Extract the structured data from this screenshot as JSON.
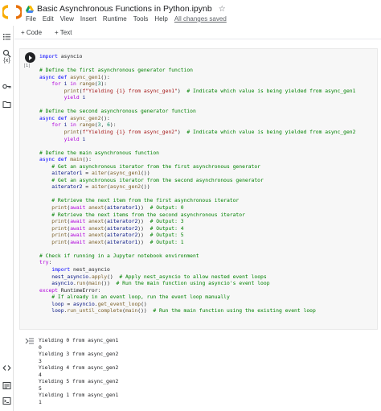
{
  "header": {
    "title": "Basic Asynchronous Functions in Python.ipynb",
    "star_glyph": "☆",
    "menu": [
      "File",
      "Edit",
      "View",
      "Insert",
      "Runtime",
      "Tools",
      "Help"
    ],
    "saved_status": "All changes saved"
  },
  "toolbar": {
    "add_code_label": "+ Code",
    "add_text_label": "+ Text"
  },
  "rail": {
    "icons": [
      "toc-icon",
      "search-icon",
      "variables-icon",
      "secrets-key-icon",
      "folder-icon",
      "code-snippets-icon",
      "command-palette-icon",
      "terminal-icon"
    ],
    "variables_glyph": "{x}"
  },
  "cell": {
    "exec_count": "[1]",
    "code_lines": [
      [
        [
          "kw",
          "import"
        ],
        [
          "p",
          " asyncio"
        ]
      ],
      [],
      [
        [
          "cmt",
          "# Define the first asynchronous generator function"
        ]
      ],
      [
        [
          "kw",
          "async def"
        ],
        [
          "fn",
          " async_gen1"
        ],
        [
          "p",
          "():"
        ]
      ],
      [
        [
          "p",
          "    "
        ],
        [
          "ctl",
          "for"
        ],
        [
          "var",
          " i"
        ],
        [
          "ctl",
          " in"
        ],
        [
          "bi",
          " range"
        ],
        [
          "p",
          "("
        ],
        [
          "num",
          "3"
        ],
        [
          "p",
          "):"
        ]
      ],
      [
        [
          "p",
          "        "
        ],
        [
          "bi",
          "print"
        ],
        [
          "p",
          "("
        ],
        [
          "str",
          "f\"Yielding {i} from async_gen1\""
        ],
        [
          "p",
          ")  "
        ],
        [
          "cmt",
          "# Indicate which value is being yielded from async_gen1"
        ]
      ],
      [
        [
          "p",
          "        "
        ],
        [
          "ctl",
          "yield"
        ],
        [
          "var",
          " i"
        ]
      ],
      [],
      [
        [
          "cmt",
          "# Define the second asynchronous generator function"
        ]
      ],
      [
        [
          "kw",
          "async def"
        ],
        [
          "fn",
          " async_gen2"
        ],
        [
          "p",
          "():"
        ]
      ],
      [
        [
          "p",
          "    "
        ],
        [
          "ctl",
          "for"
        ],
        [
          "var",
          " i"
        ],
        [
          "ctl",
          " in"
        ],
        [
          "bi",
          " range"
        ],
        [
          "p",
          "("
        ],
        [
          "num",
          "3"
        ],
        [
          "p",
          ", "
        ],
        [
          "num",
          "6"
        ],
        [
          "p",
          "):"
        ]
      ],
      [
        [
          "p",
          "        "
        ],
        [
          "bi",
          "print"
        ],
        [
          "p",
          "("
        ],
        [
          "str",
          "f\"Yielding {i} from async_gen2\""
        ],
        [
          "p",
          ")  "
        ],
        [
          "cmt",
          "# Indicate which value is being yielded from async_gen2"
        ]
      ],
      [
        [
          "p",
          "        "
        ],
        [
          "ctl",
          "yield"
        ],
        [
          "var",
          " i"
        ]
      ],
      [],
      [
        [
          "cmt",
          "# Define the main asynchronous function"
        ]
      ],
      [
        [
          "kw",
          "async def"
        ],
        [
          "fn",
          " main"
        ],
        [
          "p",
          "():"
        ]
      ],
      [
        [
          "p",
          "    "
        ],
        [
          "cmt",
          "# Get an asynchronous iterator from the first asynchronous generator"
        ]
      ],
      [
        [
          "p",
          "    "
        ],
        [
          "var",
          "aiterator1"
        ],
        [
          "p",
          " = "
        ],
        [
          "bi",
          "aiter"
        ],
        [
          "p",
          "("
        ],
        [
          "fn",
          "async_gen1"
        ],
        [
          "p",
          "())"
        ]
      ],
      [
        [
          "p",
          "    "
        ],
        [
          "cmt",
          "# Get an asynchronous iterator from the second asynchronous generator"
        ]
      ],
      [
        [
          "p",
          "    "
        ],
        [
          "var",
          "aiterator2"
        ],
        [
          "p",
          " = "
        ],
        [
          "bi",
          "aiter"
        ],
        [
          "p",
          "("
        ],
        [
          "fn",
          "async_gen2"
        ],
        [
          "p",
          "())"
        ]
      ],
      [],
      [
        [
          "p",
          "    "
        ],
        [
          "cmt",
          "# Retrieve the next item from the first asynchronous iterator"
        ]
      ],
      [
        [
          "p",
          "    "
        ],
        [
          "bi",
          "print"
        ],
        [
          "p",
          "("
        ],
        [
          "ctl",
          "await"
        ],
        [
          "bi",
          " anext"
        ],
        [
          "p",
          "("
        ],
        [
          "var",
          "aiterator1"
        ],
        [
          "p",
          "))  "
        ],
        [
          "cmt",
          "# Output: 0"
        ]
      ],
      [
        [
          "p",
          "    "
        ],
        [
          "cmt",
          "# Retrieve the next items from the second asynchronous iterator"
        ]
      ],
      [
        [
          "p",
          "    "
        ],
        [
          "bi",
          "print"
        ],
        [
          "p",
          "("
        ],
        [
          "ctl",
          "await"
        ],
        [
          "bi",
          " anext"
        ],
        [
          "p",
          "("
        ],
        [
          "var",
          "aiterator2"
        ],
        [
          "p",
          "))  "
        ],
        [
          "cmt",
          "# Output: 3"
        ]
      ],
      [
        [
          "p",
          "    "
        ],
        [
          "bi",
          "print"
        ],
        [
          "p",
          "("
        ],
        [
          "ctl",
          "await"
        ],
        [
          "bi",
          " anext"
        ],
        [
          "p",
          "("
        ],
        [
          "var",
          "aiterator2"
        ],
        [
          "p",
          "))  "
        ],
        [
          "cmt",
          "# Output: 4"
        ]
      ],
      [
        [
          "p",
          "    "
        ],
        [
          "bi",
          "print"
        ],
        [
          "p",
          "("
        ],
        [
          "ctl",
          "await"
        ],
        [
          "bi",
          " anext"
        ],
        [
          "p",
          "("
        ],
        [
          "var",
          "aiterator2"
        ],
        [
          "p",
          "))  "
        ],
        [
          "cmt",
          "# Output: 5"
        ]
      ],
      [
        [
          "p",
          "    "
        ],
        [
          "bi",
          "print"
        ],
        [
          "p",
          "("
        ],
        [
          "ctl",
          "await"
        ],
        [
          "bi",
          " anext"
        ],
        [
          "p",
          "("
        ],
        [
          "var",
          "aiterator1"
        ],
        [
          "p",
          "))  "
        ],
        [
          "cmt",
          "# Output: 1"
        ]
      ],
      [],
      [
        [
          "cmt",
          "# Check if running in a Jupyter notebook environment"
        ]
      ],
      [
        [
          "ctl",
          "try"
        ],
        [
          "p",
          ":"
        ]
      ],
      [
        [
          "p",
          "    "
        ],
        [
          "kw",
          "import"
        ],
        [
          "p",
          " nest_asyncio"
        ]
      ],
      [
        [
          "p",
          "    "
        ],
        [
          "var",
          "nest_asyncio"
        ],
        [
          "p",
          "."
        ],
        [
          "fn",
          "apply"
        ],
        [
          "p",
          "()  "
        ],
        [
          "cmt",
          "# Apply nest_asyncio to allow nested event loops"
        ]
      ],
      [
        [
          "p",
          "    "
        ],
        [
          "var",
          "asyncio"
        ],
        [
          "p",
          "."
        ],
        [
          "fn",
          "run"
        ],
        [
          "p",
          "("
        ],
        [
          "fn",
          "main"
        ],
        [
          "p",
          "())  "
        ],
        [
          "cmt",
          "# Run the main function using asyncio's event loop"
        ]
      ],
      [
        [
          "ctl",
          "except"
        ],
        [
          "p",
          " RuntimeError:"
        ]
      ],
      [
        [
          "p",
          "    "
        ],
        [
          "cmt",
          "# If already in an event loop, run the event loop manually"
        ]
      ],
      [
        [
          "p",
          "    "
        ],
        [
          "var",
          "loop"
        ],
        [
          "p",
          " = "
        ],
        [
          "var",
          "asyncio"
        ],
        [
          "p",
          "."
        ],
        [
          "fn",
          "get_event_loop"
        ],
        [
          "p",
          "()"
        ]
      ],
      [
        [
          "p",
          "    "
        ],
        [
          "var",
          "loop"
        ],
        [
          "p",
          "."
        ],
        [
          "fn",
          "run_until_complete"
        ],
        [
          "p",
          "("
        ],
        [
          "fn",
          "main"
        ],
        [
          "p",
          "())  "
        ],
        [
          "cmt",
          "# Run the main function using the existing event loop"
        ]
      ]
    ]
  },
  "output": {
    "lines": [
      "Yielding 0 from async_gen1",
      "0",
      "Yielding 3 from async_gen2",
      "3",
      "Yielding 4 from async_gen2",
      "4",
      "Yielding 5 from async_gen2",
      "5",
      "Yielding 1 from async_gen1",
      "1"
    ]
  },
  "colors": {
    "keyword": "#0000ff",
    "control": "#af00db",
    "function": "#795e26",
    "string": "#a31515",
    "number": "#098658",
    "comment": "#008000",
    "variable": "#001080",
    "logo_orange": "#f9ab00",
    "logo_dark_orange": "#e8710a"
  }
}
